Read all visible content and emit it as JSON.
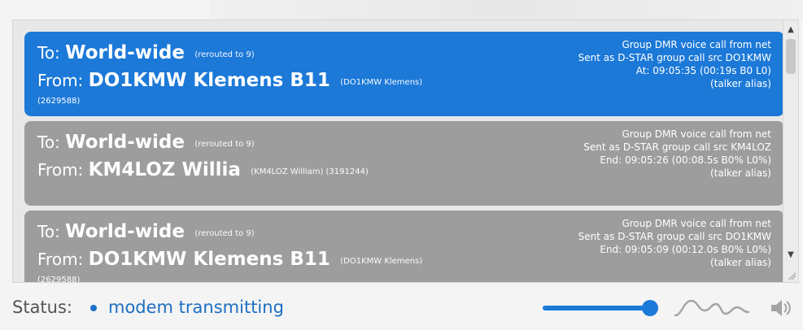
{
  "calls": [
    {
      "to_label": "To:",
      "target": "World-wide",
      "target_note": "(rerouted to 9)",
      "from_label": "From:",
      "source": "DO1KMW Klemens B11",
      "source_note": "(DO1KMW Klemens)",
      "dmr_id": "(2629588)",
      "detail_1": "Group DMR voice call from net",
      "detail_2": "Sent as D-STAR group call src DO1KMW",
      "detail_3": "At: 09:05:35 (00:19s B0 L0)",
      "detail_4": "(talker alias)",
      "state": "active"
    },
    {
      "to_label": "To:",
      "target": "World-wide",
      "target_note": "(rerouted to 9)",
      "from_label": "From:",
      "source": "KM4LOZ Willia",
      "source_note": "(KM4LOZ William) (3191244)",
      "dmr_id": "",
      "detail_1": "Group DMR voice call from net",
      "detail_2": "Sent as D-STAR group call src KM4LOZ",
      "detail_3": "End: 09:05:26 (00:08.5s B0% L0%)",
      "detail_4": "(talker alias)",
      "state": "inactive"
    },
    {
      "to_label": "To:",
      "target": "World-wide",
      "target_note": "(rerouted to 9)",
      "from_label": "From:",
      "source": "DO1KMW Klemens B11",
      "source_note": "(DO1KMW Klemens)",
      "dmr_id": "(2629588)",
      "detail_1": "Group DMR voice call from net",
      "detail_2": "Sent as D-STAR group call src DO1KMW",
      "detail_3": "End: 09:05:09 (00:12.0s B0% L0%)",
      "detail_4": "(talker alias)",
      "state": "inactive"
    }
  ],
  "status": {
    "label": "Status:",
    "value": "modem transmitting"
  },
  "volume": {
    "level": 1.0
  },
  "icons": {
    "waveform": "waveform-icon",
    "speaker": "speaker-icon",
    "scroll_up": "chevron-up-icon",
    "scroll_down": "chevron-down-icon"
  },
  "colors": {
    "active_card": "#1c79d8",
    "inactive_card": "#9d9d9d",
    "status_accent": "#1d6fc4"
  }
}
